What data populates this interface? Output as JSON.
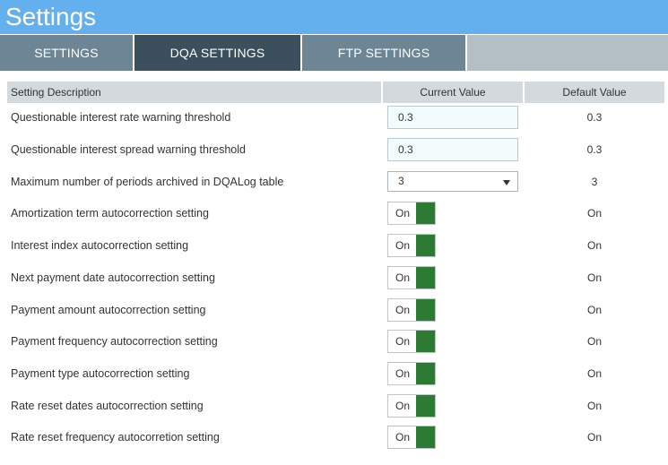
{
  "page": {
    "title": "Settings"
  },
  "tabs": [
    {
      "label": "SETTINGS",
      "active": false
    },
    {
      "label": "DQA SETTINGS",
      "active": true
    },
    {
      "label": "FTP SETTINGS",
      "active": false
    }
  ],
  "table": {
    "headers": {
      "description": "Setting Description",
      "current": "Current Value",
      "default": "Default Value"
    },
    "rows": [
      {
        "description": "Questionable interest rate warning threshold",
        "type": "input",
        "current": "0.3",
        "default": "0.3"
      },
      {
        "description": "Questionable interest spread warning threshold",
        "type": "input",
        "current": "0.3",
        "default": "0.3"
      },
      {
        "description": "Maximum number of periods archived in DQALog table",
        "type": "select",
        "current": "3",
        "default": "3"
      },
      {
        "description": "Amortization term autocorrection setting",
        "type": "toggle",
        "current": "On",
        "default": "On"
      },
      {
        "description": "Interest index autocorrection setting",
        "type": "toggle",
        "current": "On",
        "default": "On"
      },
      {
        "description": "Next payment date autocorrection setting",
        "type": "toggle",
        "current": "On",
        "default": "On"
      },
      {
        "description": "Payment amount autocorrection setting",
        "type": "toggle",
        "current": "On",
        "default": "On"
      },
      {
        "description": "Payment frequency autocorrection setting",
        "type": "toggle",
        "current": "On",
        "default": "On"
      },
      {
        "description": "Payment type autocorrection setting",
        "type": "toggle",
        "current": "On",
        "default": "On"
      },
      {
        "description": "Rate reset dates autocorrection setting",
        "type": "toggle",
        "current": "On",
        "default": "On"
      },
      {
        "description": "Rate reset frequency autocorretion setting",
        "type": "toggle",
        "current": "On",
        "default": "On"
      }
    ]
  },
  "colors": {
    "titlebar": "#64b0ee",
    "tab": "#6d8594",
    "tab_active": "#3c4f5c",
    "toggle_on": "#2d7a34"
  }
}
